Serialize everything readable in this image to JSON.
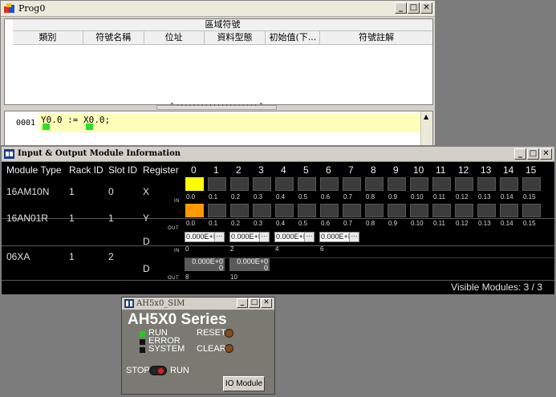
{
  "prog0": {
    "title": "Prog0",
    "group_header": "區域符號",
    "columns": [
      "類別",
      "符號名稱",
      "位址",
      "資料型態",
      "初始值(下...",
      "符號註解"
    ],
    "line_number": "0001",
    "code": "Y0.0 := X0.0;"
  },
  "io_window": {
    "title": "Input & Output Module Information",
    "headers": {
      "module_type": "Module Type",
      "rack_id": "Rack ID",
      "slot_id": "Slot ID",
      "register": "Register",
      "bits": [
        "0",
        "1",
        "2",
        "3",
        "4",
        "5",
        "6",
        "7",
        "8",
        "9",
        "10",
        "11",
        "12",
        "13",
        "14",
        "15"
      ]
    },
    "bit_labels": [
      "0.0",
      "0.1",
      "0.2",
      "0.3",
      "0.4",
      "0.5",
      "0.6",
      "0.7",
      "0.8",
      "0.9",
      "0.10",
      "0.11",
      "0.12",
      "0.13",
      "0.14",
      "0.15"
    ],
    "rows": [
      {
        "module_type": "16AM10N",
        "rack_id": "1",
        "slot_id": "0",
        "register": "X",
        "direction": "IN",
        "active_bit": 0,
        "active_color": "#ffff00"
      },
      {
        "module_type": "16AN01R",
        "rack_id": "1",
        "slot_id": "1",
        "register": "Y",
        "direction": "OUT",
        "active_bit": 0,
        "active_color": "#ff9900"
      },
      {
        "module_type": "06XA",
        "rack_id": "1",
        "slot_id": "2",
        "register_in": "D",
        "register_out": "D",
        "direction_in": "IN",
        "direction_out": "OUT"
      }
    ],
    "analog_in": [
      {
        "value": "0.000E+I",
        "index": "0"
      },
      {
        "value": "0.000E+I",
        "index": "2"
      },
      {
        "value": "0.000E+I",
        "index": "4"
      },
      {
        "value": "0.000E+I",
        "index": "6"
      }
    ],
    "analog_out": [
      {
        "value": "0.000E+0",
        "sub": "0",
        "index": "8"
      },
      {
        "value": "0.000E+0",
        "sub": "0",
        "index": "10"
      }
    ],
    "status": "Visible Modules: 3 / 3"
  },
  "sim_window": {
    "title": "AH5x0_SIM",
    "series": "AH5X0 Series",
    "leds": [
      {
        "label": "RUN",
        "color": "#22cc22"
      },
      {
        "label": "ERROR",
        "color": "#111111"
      },
      {
        "label": "SYSTEM",
        "color": "#111111"
      }
    ],
    "reset_label": "RESET",
    "clear_label": "CLEAR",
    "stop_label": "STOP",
    "run_label": "RUN",
    "io_button": "IO Module"
  }
}
